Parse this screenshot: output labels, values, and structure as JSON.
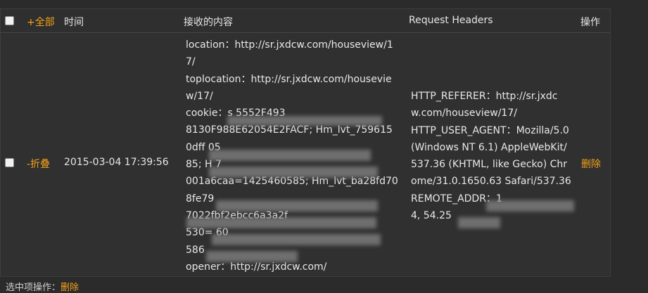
{
  "header": {
    "expand_all": "+全部",
    "col_time": "时间",
    "col_content": "接收的内容",
    "col_headers": "Request Headers",
    "col_action": "操作"
  },
  "row": {
    "collapse": "-折叠",
    "time": "2015-03-04 17:39:56",
    "content_lines": [
      "location：http://sr.jxdcw.com/houseview/1",
      "7/",
      "toplocation：http://sr.jxdcw.com/housevie",
      "w/17/",
      "cookie：s                          5552F493",
      "8130F988E62054E2FACF; Hm_lvt_759615",
      "0dff                                   05",
      "85; H                                   7",
      "001a6caa=1425460585; Hm_lvt_ba28fd70",
      "8fe79",
      "                   7022fbf2ebcc6a3a2f",
      "530=                                 60",
      "586",
      "opener：http://sr.jxdcw.com/"
    ],
    "header_lines": [
      "HTTP_REFERER：http://sr.jxdc",
      "w.com/houseview/17/",
      "HTTP_USER_AGENT：Mozilla/5.0",
      "(Windows NT 6.1) AppleWebKit/",
      "537.36 (KHTML, like Gecko) Chr",
      "ome/31.0.1650.63 Safari/537.36",
      "REMOTE_ADDR：1",
      "4, 54.25"
    ],
    "delete": "删除"
  },
  "footer": {
    "label": "选中项操作：",
    "delete": "删除"
  },
  "colors": {
    "accent": "#f3a11a",
    "background": "#2b2b2b"
  }
}
